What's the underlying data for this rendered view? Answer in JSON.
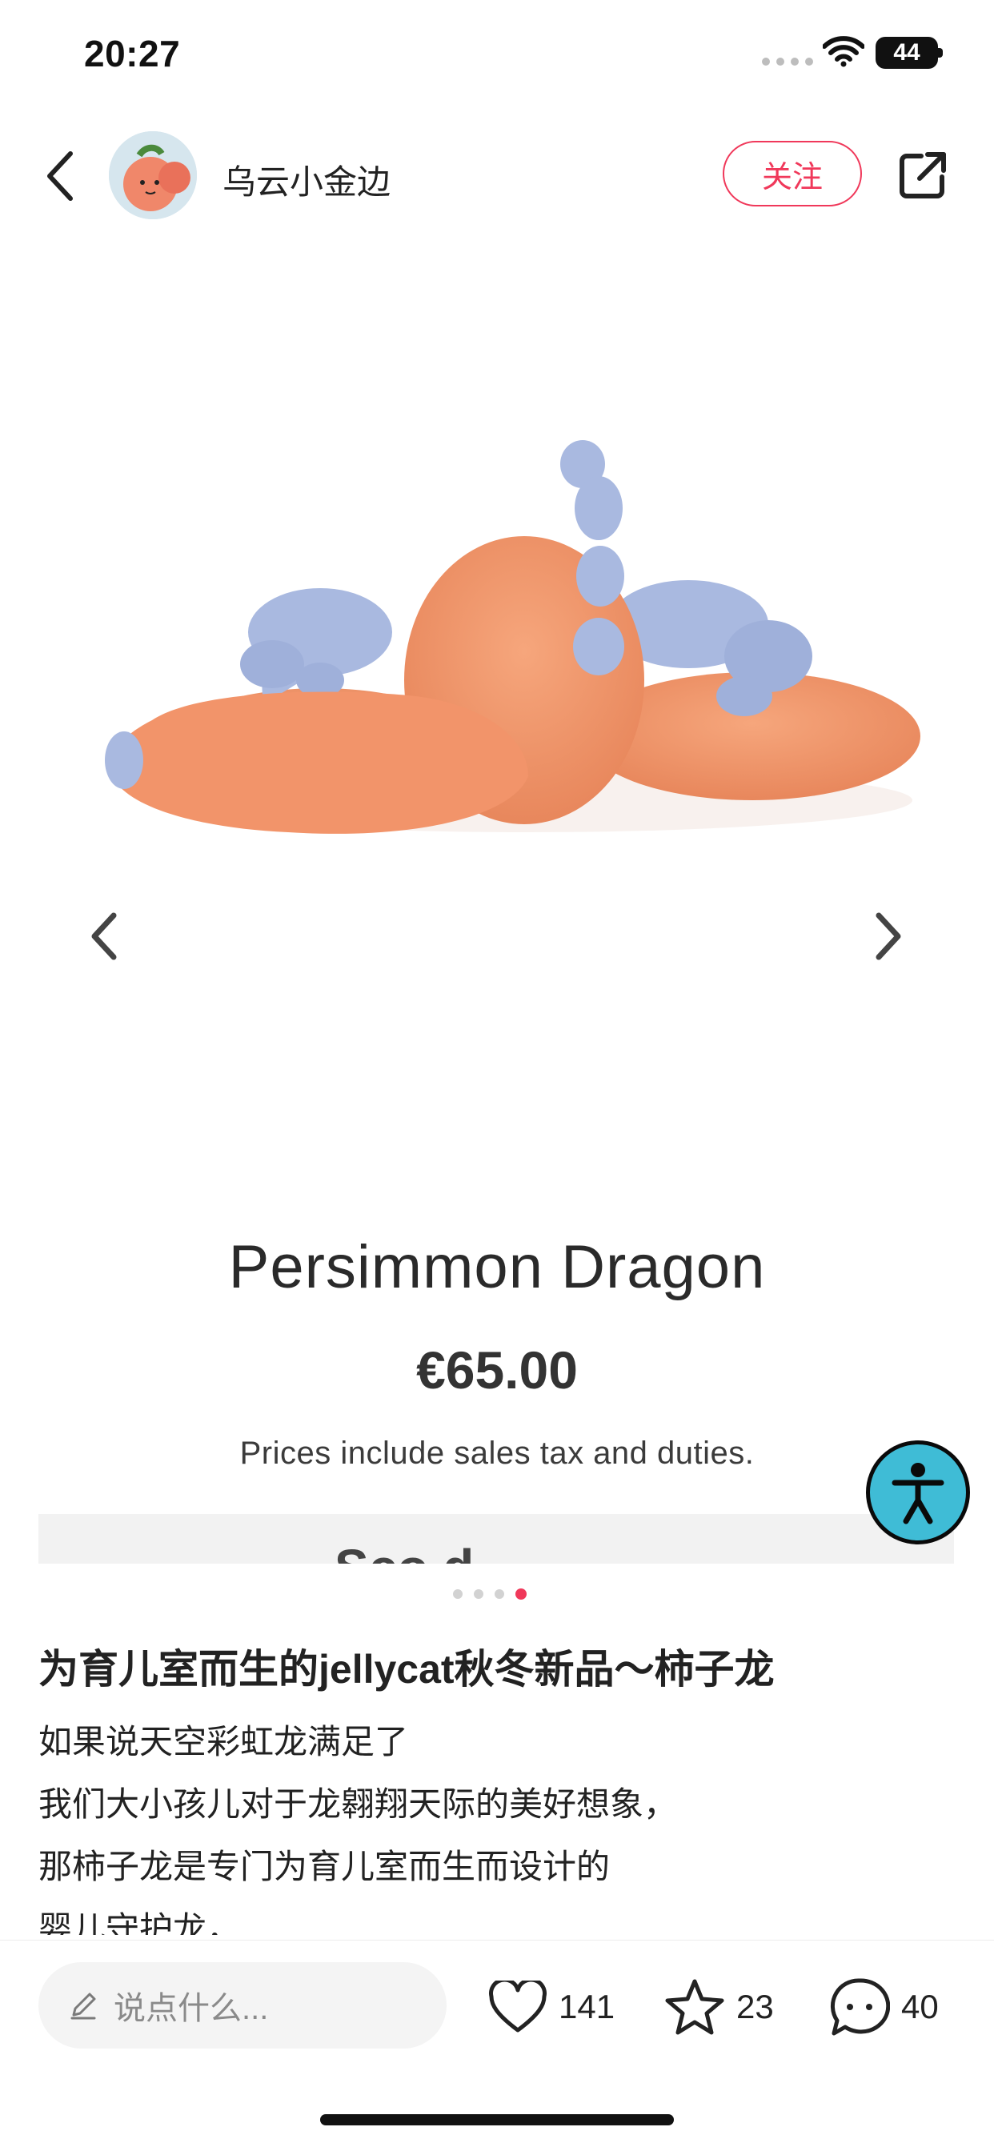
{
  "status_bar": {
    "time": "20:27",
    "battery": "44"
  },
  "header": {
    "username": "乌云小金边",
    "follow_label": "关注"
  },
  "product": {
    "name": "Persimmon Dragon",
    "price": "€65.00",
    "tax_note": "Prices include sales tax and duties.",
    "strip_partial_text": "Sco          d"
  },
  "carousel": {
    "page_count": 4,
    "active_index": 3
  },
  "post": {
    "title": "为育儿室而生的jellycat秋冬新品～柿子龙",
    "body_lines": [
      "如果说天空彩虹龙满足了",
      "我们大小孩儿对于龙翱翔天际的美好想象，",
      "那柿子龙是专门为育儿室而生而设计的",
      "婴儿守护龙，"
    ]
  },
  "bottom_bar": {
    "comment_placeholder": "说点什么...",
    "likes": "141",
    "stars": "23",
    "comments": "40"
  },
  "colors": {
    "accent": "#f0385a",
    "accessibility": "#3fbcd6",
    "plush_body": "#f09a6f",
    "plush_spikes": "#a9b9e0"
  }
}
